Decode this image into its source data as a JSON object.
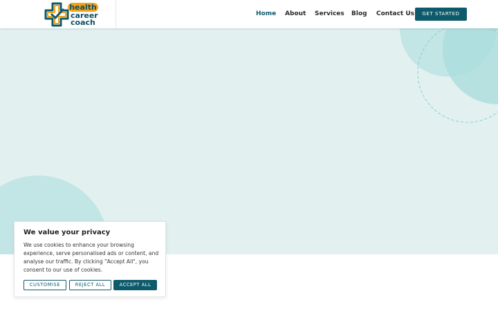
{
  "logo": {
    "line1": "health",
    "line2": "career",
    "line3": "coach",
    "icon": "cross-check-icon"
  },
  "nav": {
    "items": [
      {
        "label": "Home",
        "active": true
      },
      {
        "label": "About",
        "active": false
      },
      {
        "label": "Services",
        "active": false
      },
      {
        "label": "Blog",
        "active": false
      },
      {
        "label": "Contact Us",
        "active": false
      }
    ],
    "cta_label": "GET STARTED"
  },
  "cookie_banner": {
    "title": "We value your privacy",
    "text": "We use cookies to enhance your browsing experience, serve personalised ads or content, and analyse our traffic. By clicking \"Accept All\", you consent to our use of cookies.",
    "customise_label": "CUSTOMISE",
    "reject_label": "REJECT ALL",
    "accept_label": "ACCEPT ALL"
  },
  "colors": {
    "brand_teal": "#0d5a6b",
    "brand_orange": "#f2a31b",
    "hero_bg": "#e2f0f0",
    "circle_light": "#c2e5e5",
    "circle_mid": "#a8dcdc"
  }
}
